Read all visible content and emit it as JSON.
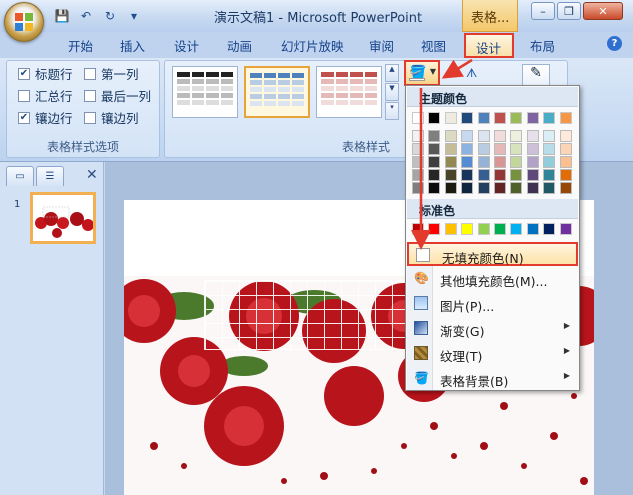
{
  "window": {
    "title": "演示文稿1 - Microsoft PowerPoint",
    "context_tab": "表格...",
    "controls": {
      "minimize": "–",
      "restore": "❐",
      "close": "✕"
    }
  },
  "quick_access": [
    {
      "name": "save-icon",
      "glyph": "💾"
    },
    {
      "name": "undo-icon",
      "glyph": "↶"
    },
    {
      "name": "redo-icon",
      "glyph": "↻"
    },
    {
      "name": "customize-icon",
      "glyph": "▾"
    }
  ],
  "tabs": [
    "开始",
    "插入",
    "设计",
    "动画",
    "幻灯片放映",
    "审阅",
    "视图"
  ],
  "tab_design_active": "设计",
  "tab_layout": "布局",
  "ribbon": {
    "style_options": {
      "label": "表格样式选项",
      "items": [
        {
          "label": "标题行",
          "checked": true
        },
        {
          "label": "第一列",
          "checked": false
        },
        {
          "label": "汇总行",
          "checked": false
        },
        {
          "label": "最后一列",
          "checked": false
        },
        {
          "label": "镶边行",
          "checked": true
        },
        {
          "label": "镶边列",
          "checked": false
        }
      ]
    },
    "table_styles": {
      "label": "表格样式"
    }
  },
  "dropdown": {
    "theme_colors_label": "主题颜色",
    "standard_colors_label": "标准色",
    "theme_top_row": [
      "#ffffff",
      "#000000",
      "#eeece1",
      "#1f497d",
      "#4f81bd",
      "#c0504d",
      "#9bbb59",
      "#8064a2",
      "#4bacc6",
      "#f79646"
    ],
    "theme_columns": [
      [
        "#f2f2f2",
        "#d8d8d8",
        "#bfbfbf",
        "#a5a5a5",
        "#7f7f7f"
      ],
      [
        "#7f7f7f",
        "#595959",
        "#3f3f3f",
        "#262626",
        "#0c0c0c"
      ],
      [
        "#ddd9c3",
        "#c4bd97",
        "#938953",
        "#494429",
        "#1d1b10"
      ],
      [
        "#c6d9f0",
        "#8db3e2",
        "#548dd4",
        "#17365d",
        "#0f243e"
      ],
      [
        "#dbe5f1",
        "#b8cce4",
        "#95b3d7",
        "#366092",
        "#244061"
      ],
      [
        "#f2dcdb",
        "#e5b9b7",
        "#d99694",
        "#953734",
        "#632423"
      ],
      [
        "#ebf1dd",
        "#d7e3bc",
        "#c3d69b",
        "#76923c",
        "#4f6128"
      ],
      [
        "#e5e0ec",
        "#ccc1d9",
        "#b2a2c7",
        "#5f497a",
        "#3f3151"
      ],
      [
        "#dbeef3",
        "#b7dde8",
        "#92cddc",
        "#31859b",
        "#205867"
      ],
      [
        "#fdeada",
        "#fbd5b5",
        "#fac08f",
        "#e36c09",
        "#974806"
      ]
    ],
    "standard": [
      "#c00000",
      "#ff0000",
      "#ffc000",
      "#ffff00",
      "#92d050",
      "#00b050",
      "#00b0f0",
      "#0070c0",
      "#002060",
      "#7030a0"
    ],
    "items": [
      {
        "label": "无填充颜色(N)",
        "icon": "no-fill-icon",
        "submenu": false
      },
      {
        "label": "其他填充颜色(M)...",
        "icon": "more-colors-icon",
        "submenu": false
      },
      {
        "label": "图片(P)...",
        "icon": "picture-icon",
        "submenu": false
      },
      {
        "label": "渐变(G)",
        "icon": "gradient-icon",
        "submenu": true
      },
      {
        "label": "纹理(T)",
        "icon": "texture-icon",
        "submenu": true
      },
      {
        "label": "表格背景(B)",
        "icon": "table-background-icon",
        "submenu": true
      }
    ]
  },
  "slide_pane": {
    "slide_number": "1"
  }
}
